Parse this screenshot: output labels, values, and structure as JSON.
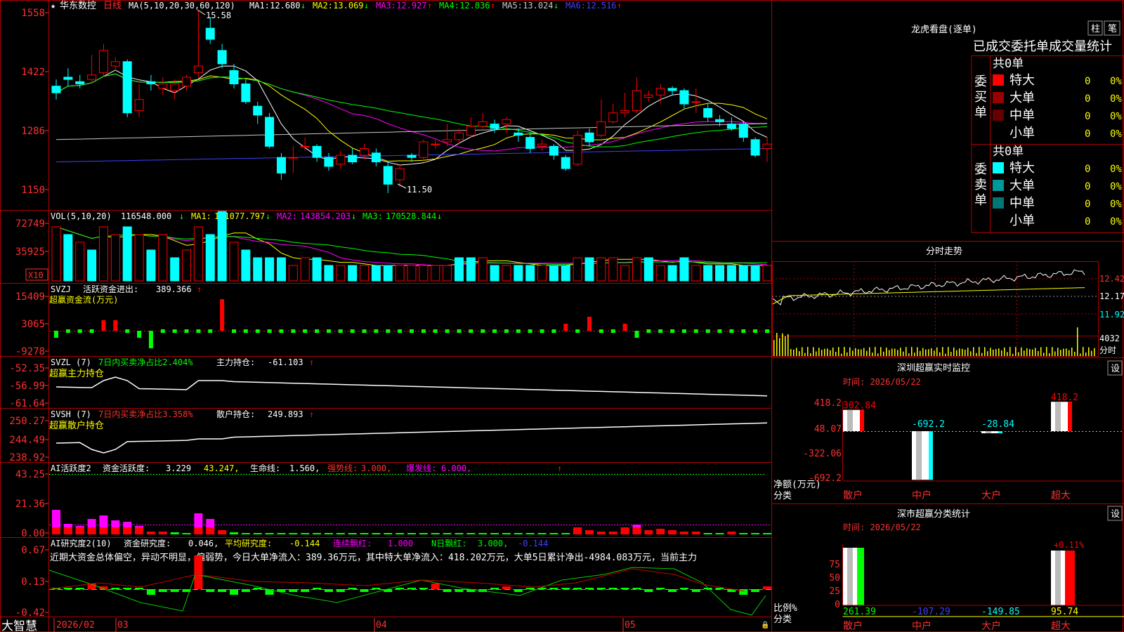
{
  "stock": {
    "name": "华东数控",
    "period": "日线",
    "ma_label": "MA(5,10,20,30,60,120)"
  },
  "colors": {
    "up": "#ff0000",
    "down": "#00ffff",
    "grid": "#b00000",
    "axis_text": "#ff3030",
    "green": "#00ff00",
    "yellow": "#ffff00",
    "magenta": "#ff00ff",
    "label_blue": "#5050ff",
    "orange": "#ffa500"
  },
  "price_panel": {
    "y_ticks": [
      "1558",
      "1422",
      "1286",
      "1150"
    ],
    "ma_values": [
      {
        "label": "MA1:",
        "value": "12.680",
        "arrow": "↓",
        "color": "#ffffff"
      },
      {
        "label": "MA2:",
        "value": "13.069",
        "arrow": "↓",
        "color": "#ffff00"
      },
      {
        "label": "MA3:",
        "value": "12.927",
        "arrow": "↑",
        "color": "#ff00ff"
      },
      {
        "label": "MA4:",
        "value": "12.836",
        "arrow": "↑",
        "color": "#00ff00"
      },
      {
        "label": "MA5:",
        "value": "13.024",
        "arrow": "↓",
        "color": "#c8c8c8"
      },
      {
        "label": "MA6:",
        "value": "12.516",
        "arrow": "↑",
        "color": "#4040ff"
      }
    ],
    "high_mark": "15.58",
    "low_mark": "11.50"
  },
  "volume_panel": {
    "header": "VOL(5,10,20)",
    "value": "116548.000",
    "value_arrow": "↓",
    "ma": [
      {
        "label": "MA1:",
        "value": "121077.797",
        "arrow": "↓",
        "color": "#ffff00"
      },
      {
        "label": "MA2:",
        "value": "143854.203",
        "arrow": "↓",
        "color": "#ff00ff"
      },
      {
        "label": "MA3:",
        "value": "170528.844",
        "arrow": "↓",
        "color": "#00ff00"
      }
    ],
    "y_ticks": [
      "72749",
      "35925"
    ],
    "unit": "X10"
  },
  "svzj_panel": {
    "header": "SVZJ",
    "title": "活跃资金进出:",
    "value": "389.366",
    "arrow": "↑",
    "subtitle": "超赢资金流(万元)",
    "y_ticks": [
      "15409",
      "3065",
      "-9278"
    ]
  },
  "svzl_panel": {
    "header": "SVZL (7)",
    "ratio_text": "7日内买卖净占比2.404%",
    "hold_label": "主力持仓:",
    "value": "-61.103",
    "arrow": "↑",
    "subtitle": "超赢主力持仓",
    "y_ticks": [
      "-52.35",
      "-56.99",
      "-61.64"
    ]
  },
  "svsh_panel": {
    "header": "SVSH (7)",
    "ratio_text": "7日内买卖净占比3.358%",
    "hold_label": "散户持仓:",
    "value": "249.893",
    "arrow": "↑",
    "subtitle": "超赢散户持仓",
    "y_ticks": [
      "250.27",
      "244.49",
      "238.92"
    ]
  },
  "ai_active_panel": {
    "header": "AI活跃度2",
    "label1": "资金活跃度:",
    "value1": "3.229",
    "value2": "43.247,",
    "label3": "生命线:",
    "value3": "1.560,",
    "label4": "强势线:",
    "value4": "3.000,",
    "label5": "爆发线:",
    "value5": "6.000,",
    "y_ticks": [
      "43.25",
      "21.36",
      "0.00"
    ]
  },
  "ai_research_panel": {
    "header": "AI研究度2(10)",
    "label1": "资金研究度:",
    "value1": "0.046,",
    "label2": "平均研究度:",
    "value2": "-0.144",
    "label3": "连续飘红:",
    "value3": "1.000",
    "label4": "N日飘红:",
    "value4": "3.000,",
    "value5": "-0.144",
    "commentary": "近期大资金总体偏空，异动不明显，偏弱势，今日大单净流入：389.36万元，其中特大单净流入：418.202万元，大单5日累计净出-4984.083万元，当前主力",
    "y_ticks": [
      "0.67",
      "0.13",
      "-0.42"
    ]
  },
  "x_axis": {
    "labels": [
      "2026/02",
      "03",
      "04",
      "05"
    ],
    "brand": "大智慧"
  },
  "dragon_tiger": {
    "title": "龙虎看盘(逐单)",
    "btn_bar": "柱",
    "btn_detail": "笔",
    "tabs": [
      "已成交",
      "委托单",
      "成交量统计"
    ],
    "buy": {
      "side_label": "委买单",
      "total": "共0单",
      "rows": [
        {
          "name": "特大",
          "count": "0",
          "pct": "0%",
          "color": "#ff0000"
        },
        {
          "name": "大单",
          "count": "0",
          "pct": "0%",
          "color": "#990000"
        },
        {
          "name": "中单",
          "count": "0",
          "pct": "0%",
          "color": "#660000"
        },
        {
          "name": "小单",
          "count": "0",
          "pct": "0%",
          "color": ""
        }
      ]
    },
    "sell": {
      "side_label": "委卖单",
      "total": "共0单",
      "rows": [
        {
          "name": "特大",
          "count": "0",
          "pct": "0%",
          "color": "#00ffff"
        },
        {
          "name": "大单",
          "count": "0",
          "pct": "0%",
          "color": "#009999"
        },
        {
          "name": "中单",
          "count": "0",
          "pct": "0%",
          "color": "#007777"
        },
        {
          "name": "小单",
          "count": "0",
          "pct": "0%",
          "color": ""
        }
      ]
    }
  },
  "intraday": {
    "title": "分时走势",
    "price_ticks": [
      "12.42",
      "12.17",
      "11.92"
    ],
    "volume_tick": "4032",
    "volume_label": "分时"
  },
  "sz_monitor": {
    "title": "深圳超赢实时监控",
    "settings": "设",
    "time": "时间: 2026/05/22",
    "y_ticks": [
      "418.2",
      "48.07",
      "-322.06",
      "-692.2"
    ],
    "ylabel1": "净额(万元)",
    "ylabel2": "分类",
    "categories": [
      "散户",
      "中户",
      "大户",
      "超大"
    ],
    "bar_labels": [
      "302.84",
      "-692.2",
      "-28.84",
      "418.2"
    ]
  },
  "sz_stats": {
    "title": "深市超赢分类统计",
    "settings": "设",
    "time": "时间: 2026/05/22",
    "y_ticks": [
      "75",
      "50",
      "25",
      "0"
    ],
    "ylabel1": "比例%",
    "ylabel2": "分类",
    "categories": [
      "散户",
      "中户",
      "大户",
      "超大"
    ],
    "bottom_labels": [
      "261.39",
      "-107.29",
      "-149.85",
      "95.74"
    ],
    "top_label": "+0.11%"
  },
  "chart_data": [
    {
      "type": "candlestick",
      "title": "华东数控 日线",
      "ylim": [
        11.5,
        15.58
      ],
      "candles": [
        [
          13.9,
          13.75,
          14.05,
          13.6
        ],
        [
          14.1,
          14.05,
          14.3,
          13.9
        ],
        [
          14.0,
          13.95,
          14.15,
          13.85
        ],
        [
          14.05,
          14.15,
          14.6,
          13.95
        ],
        [
          14.2,
          14.7,
          14.85,
          14.1
        ],
        [
          14.35,
          14.45,
          14.55,
          14.25
        ],
        [
          14.45,
          13.3,
          14.5,
          13.2
        ],
        [
          13.35,
          13.6,
          13.95,
          13.2
        ],
        [
          14.0,
          13.95,
          14.15,
          13.8
        ],
        [
          13.85,
          13.95,
          14.1,
          13.7
        ],
        [
          13.8,
          13.95,
          14.05,
          13.6
        ],
        [
          13.9,
          14.1,
          14.15,
          13.8
        ],
        [
          14.2,
          14.35,
          15.58,
          14.1
        ],
        [
          15.2,
          14.95,
          15.45,
          14.85
        ],
        [
          14.7,
          14.4,
          14.85,
          14.3
        ],
        [
          14.25,
          13.95,
          14.4,
          13.85
        ],
        [
          13.95,
          13.55,
          14.05,
          13.5
        ],
        [
          13.45,
          13.25,
          13.55,
          13.05
        ],
        [
          13.2,
          12.55,
          13.3,
          12.5
        ],
        [
          12.3,
          11.95,
          12.4,
          11.8
        ],
        [
          12.3,
          12.3,
          12.55,
          11.95
        ],
        [
          12.55,
          12.55,
          12.75,
          12.45
        ],
        [
          12.55,
          12.3,
          12.6,
          12.2
        ],
        [
          12.3,
          12.1,
          12.4,
          12.0
        ],
        [
          12.15,
          12.35,
          12.45,
          12.05
        ],
        [
          12.35,
          12.2,
          12.5,
          12.15
        ],
        [
          12.35,
          12.5,
          12.6,
          12.25
        ],
        [
          12.4,
          12.2,
          12.5,
          12.1
        ],
        [
          12.1,
          11.7,
          12.2,
          11.5
        ],
        [
          11.8,
          12.05,
          12.15,
          11.65
        ],
        [
          12.35,
          12.3,
          12.4,
          12.2
        ],
        [
          12.3,
          12.65,
          12.7,
          12.2
        ],
        [
          12.6,
          12.6,
          12.7,
          12.5
        ],
        [
          12.65,
          12.7,
          13.05,
          12.55
        ],
        [
          12.7,
          12.85,
          12.95,
          12.6
        ],
        [
          12.8,
          13.0,
          13.2,
          12.75
        ],
        [
          13.0,
          13.1,
          13.3,
          12.95
        ],
        [
          13.05,
          12.95,
          13.15,
          12.85
        ],
        [
          13.05,
          13.15,
          13.2,
          12.85
        ],
        [
          12.85,
          12.8,
          12.95,
          12.65
        ],
        [
          12.75,
          12.5,
          12.85,
          12.4
        ],
        [
          12.55,
          12.6,
          12.7,
          12.45
        ],
        [
          12.55,
          12.35,
          12.6,
          12.25
        ],
        [
          12.3,
          12.05,
          12.35,
          12.0
        ],
        [
          12.15,
          12.8,
          12.9,
          12.1
        ],
        [
          12.85,
          12.65,
          12.95,
          12.55
        ],
        [
          12.8,
          13.1,
          13.6,
          12.75
        ],
        [
          13.1,
          13.3,
          13.5,
          13.05
        ],
        [
          13.3,
          13.35,
          13.75,
          13.2
        ],
        [
          13.35,
          13.8,
          14.1,
          13.3
        ],
        [
          13.65,
          13.7,
          13.8,
          13.55
        ],
        [
          13.7,
          13.85,
          13.95,
          13.5
        ],
        [
          13.85,
          13.8,
          13.9,
          13.7
        ],
        [
          13.8,
          13.5,
          13.85,
          13.4
        ],
        [
          13.55,
          13.55,
          13.85,
          13.3
        ],
        [
          13.4,
          13.2,
          13.5,
          13.1
        ],
        [
          13.15,
          13.1,
          13.25,
          13.0
        ],
        [
          13.05,
          12.95,
          13.2,
          12.9
        ],
        [
          13.05,
          12.75,
          13.1,
          12.65
        ],
        [
          12.7,
          12.35,
          12.75,
          12.3
        ],
        [
          12.5,
          12.6,
          12.75,
          12.2
        ]
      ]
    },
    {
      "type": "bar",
      "title": "VOL",
      "values": [
        7,
        6,
        5,
        4,
        7,
        6,
        7,
        6,
        4,
        6,
        3,
        4,
        7,
        6,
        9,
        5,
        4,
        3,
        3,
        3,
        2,
        3,
        3,
        2,
        2,
        2,
        2,
        2,
        2,
        2,
        2,
        2,
        2,
        2,
        3,
        3,
        3,
        2,
        2,
        2,
        2,
        2,
        2,
        2,
        3,
        3,
        3,
        3,
        2,
        3,
        3,
        2,
        2,
        3,
        2,
        2,
        2,
        2,
        2,
        2,
        2
      ],
      "up": [
        1,
        0,
        1,
        0,
        1,
        1,
        0,
        1,
        0,
        1,
        0,
        1,
        1,
        0,
        0,
        1,
        0,
        0,
        0,
        0,
        1,
        1,
        0,
        0,
        1,
        0,
        1,
        0,
        0,
        1,
        1,
        1,
        1,
        1,
        0,
        0,
        1,
        0,
        1,
        0,
        0,
        1,
        0,
        0,
        1,
        0,
        1,
        1,
        1,
        1,
        0,
        1,
        0,
        0,
        1,
        0,
        0,
        0,
        0,
        0,
        1
      ]
    },
    {
      "type": "bar",
      "title": "SVZJ",
      "values": [
        -2,
        1,
        1,
        1,
        3,
        3,
        1,
        -2,
        -5,
        1,
        1,
        1,
        1,
        1,
        9,
        1,
        1,
        1,
        1,
        1,
        1,
        1,
        1,
        1,
        1,
        1,
        1,
        -1,
        -1,
        -1,
        1,
        1,
        1,
        1,
        -1,
        1,
        -1,
        -1,
        -1,
        -1,
        -1,
        -1,
        -1,
        2,
        1,
        4,
        1,
        1,
        2,
        -2,
        -1,
        -1,
        -1,
        -1,
        -1,
        -1,
        -1,
        -1,
        -1,
        -1,
        -1
      ]
    }
  ]
}
